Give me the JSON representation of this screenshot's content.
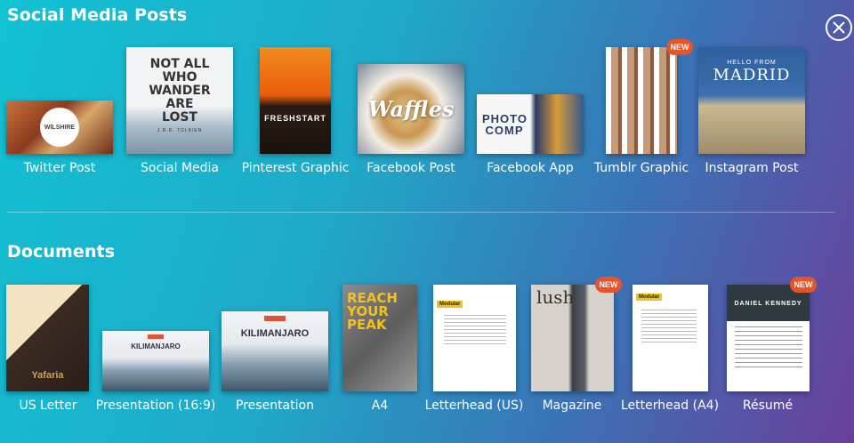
{
  "sections": {
    "social": {
      "title": "Social Media Posts"
    },
    "documents": {
      "title": "Documents"
    }
  },
  "close_icon": "close-icon",
  "social_items": [
    {
      "label": "Twitter Post",
      "thumb_text": "WILSHIRE"
    },
    {
      "label": "Social Media",
      "thumb_text": "NOT ALL WHO WANDER ARE LOST",
      "thumb_sub": "J.R.R. TOLKIEN"
    },
    {
      "label": "Pinterest Graphic",
      "thumb_text": "FRESHSTART"
    },
    {
      "label": "Facebook Post",
      "thumb_text": "Waffles"
    },
    {
      "label": "Facebook App",
      "thumb_text": "PHOTO COMP"
    },
    {
      "label": "Tumblr Graphic",
      "badge": "NEW"
    },
    {
      "label": "Instagram Post",
      "thumb_sub": "HELLO FROM",
      "thumb_text": "MADRID"
    }
  ],
  "document_items": [
    {
      "label": "US Letter",
      "thumb_text": "Yafaria"
    },
    {
      "label": "Presentation (16:9)",
      "thumb_text": "KILIMANJARO"
    },
    {
      "label": "Presentation",
      "thumb_text": "KILIMANJARO"
    },
    {
      "label": "A4",
      "thumb_text": "REACH YOUR PEAK"
    },
    {
      "label": "Letterhead (US)",
      "thumb_text": "Modular"
    },
    {
      "label": "Magazine",
      "thumb_text": "lush",
      "badge": "NEW"
    },
    {
      "label": "Letterhead (A4)",
      "thumb_text": "Modular"
    },
    {
      "label": "Résumé",
      "thumb_text": "DANIEL KENNEDY",
      "badge": "NEW"
    }
  ]
}
